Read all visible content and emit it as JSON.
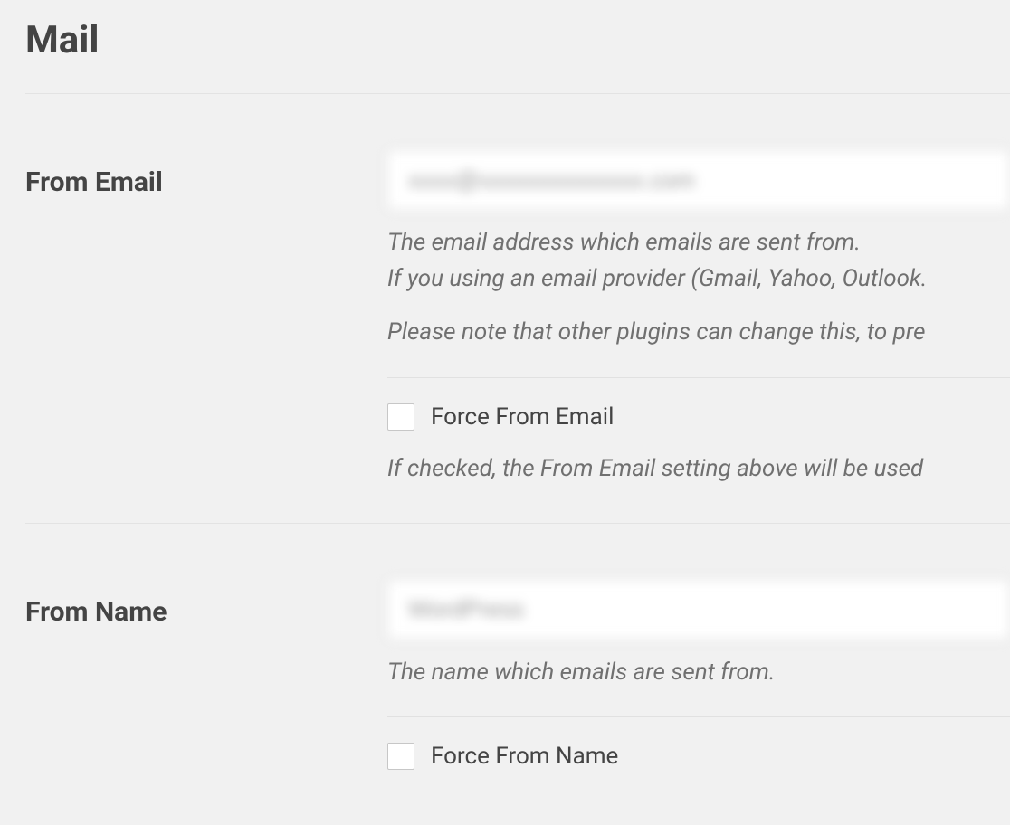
{
  "section": {
    "title": "Mail"
  },
  "from_email": {
    "label": "From Email",
    "value": "xxxx@xxxxxxxxxxxxxx.com",
    "help_line1": "The email address which emails are sent from.",
    "help_line2": "If you using an email provider (Gmail, Yahoo, Outlook.",
    "help_para2": "Please note that other plugins can change this, to pre",
    "force_checkbox_label": "Force From Email",
    "force_checkbox_checked": false,
    "force_help": "If checked, the From Email setting above will be used"
  },
  "from_name": {
    "label": "From Name",
    "value": "WordPress",
    "help_line1": "The name which emails are sent from.",
    "force_checkbox_label": "Force From Name",
    "force_checkbox_checked": false
  }
}
